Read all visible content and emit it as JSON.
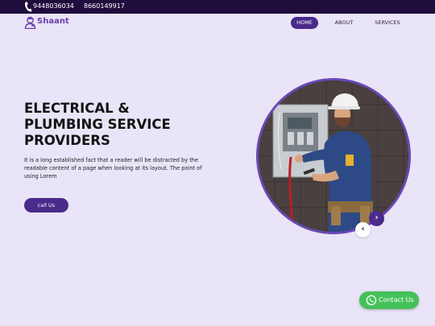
{
  "topbar": {
    "phone_icon": "phone-icon",
    "phone_1": "9448036034",
    "phone_2": "8660149917"
  },
  "brand": {
    "logo_icon": "plumber-logo-icon",
    "name": "Shaant"
  },
  "nav": {
    "items": [
      {
        "label": "HOME",
        "active": true
      },
      {
        "label": "ABOUT",
        "active": false
      },
      {
        "label": "SERVICES",
        "active": false
      }
    ]
  },
  "hero": {
    "title": "ELECTRICAL & PLUMBING SERVICE PROVIDERS",
    "text": "It is a long established fact that a reader will be distracted by the readable content of a page when looking at its layout. The point of using Lorem",
    "button_label": "call Us",
    "image_description_icon": "electrician-photo"
  },
  "carousel": {
    "prev_icon": "chevron-left-icon",
    "next_icon": "chevron-right-icon"
  },
  "contact": {
    "icon": "whatsapp-icon",
    "label": "Contact Us"
  },
  "colors": {
    "background": "#e9e4f7",
    "topbar": "#1e0d3d",
    "accent": "#4a2a8a",
    "whatsapp": "#45c15a"
  }
}
